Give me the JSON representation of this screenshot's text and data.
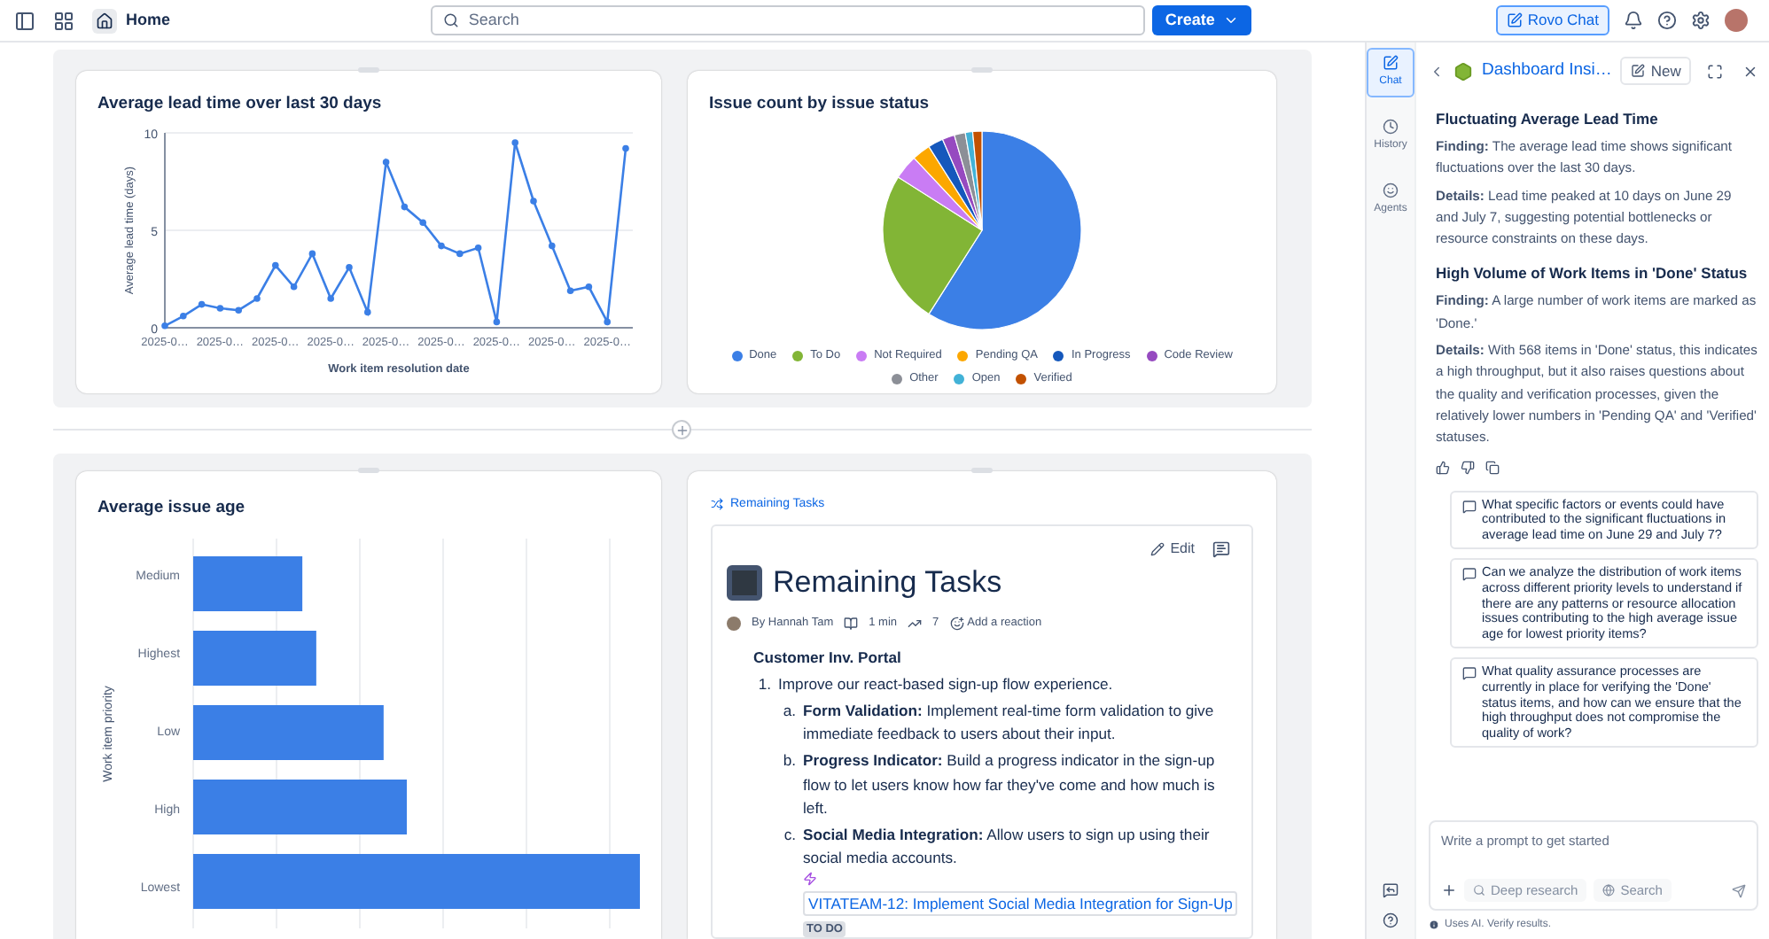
{
  "top_bar": {
    "home_label": "Home",
    "search": {
      "placeholder": "Search"
    },
    "create_button": "Create",
    "rovo_button": {
      "label": "Rovo Chat",
      "selected": true
    }
  },
  "lead_time_card": {
    "title": "Average lead time over last 30 days",
    "chart_data": {
      "type": "line",
      "xlabel": "Work item resolution date",
      "ylabel": "Average lead time (days)",
      "categories": [
        "2025-0…",
        null,
        null,
        "2025-0…",
        null,
        null,
        "2025-0…",
        null,
        null,
        "2025-0…",
        null,
        null,
        "2025-0…",
        null,
        null,
        "2025-0…",
        null,
        null,
        "2025-0…",
        null,
        null,
        "2025-0…",
        null,
        null,
        "2025-0…",
        null
      ],
      "series": [
        {
          "color": "#3b7fe6",
          "marker": true,
          "values": [
            0.1,
            0.6,
            1.2,
            1.0,
            0.9,
            1.5,
            3.2,
            2.1,
            3.8,
            1.5,
            3.1,
            0.8,
            8.5,
            6.2,
            5.4,
            4.2,
            3.8,
            4.1,
            0.3,
            9.5,
            6.5,
            4.2,
            1.9,
            2.1,
            0.3,
            9.2
          ]
        }
      ],
      "ylim": [
        0,
        10
      ],
      "yticks": [
        0,
        5,
        10
      ]
    }
  },
  "status_card": {
    "title": "Issue count by issue status",
    "legend": [
      {
        "label": "Done",
        "color": "#3b7fe6"
      },
      {
        "label": "To Do",
        "color": "#82b536"
      },
      {
        "label": "Not Required",
        "color": "#c97cf4"
      },
      {
        "label": "Pending QA",
        "color": "#fca700"
      },
      {
        "label": "In Progress",
        "color": "#1558bc"
      },
      {
        "label": "Code Review",
        "color": "#964ac0"
      },
      {
        "label": "Other",
        "color": "#8c8f97"
      },
      {
        "label": "Open",
        "color": "#42b2d7"
      },
      {
        "label": "Verified",
        "color": "#c25100"
      }
    ]
  },
  "age_card": {
    "title": "Average issue age",
    "ylabel": "Work item priority",
    "categories": [
      "Medium",
      "Highest",
      "Low",
      "High",
      "Lowest"
    ]
  },
  "page_card": {
    "link": "Remaining Tasks",
    "edit_button": "Edit",
    "title": "Remaining Tasks",
    "byline": {
      "author": "By Hannah Tam",
      "read_time": "1 min",
      "views": "7",
      "reaction": "Add a reaction"
    },
    "section": "Customer Inv. Portal",
    "list": [
      {
        "marker": "1.",
        "text": "Improve our react-based sign-up flow experience.",
        "children": [
          {
            "marker": "a.",
            "text": "**Form Validation:** Implement real-time form validation to give immediate feedback to users about their input."
          },
          {
            "marker": "b.",
            "text": "**Progress Indicator:** Build a progress indicator in the sign-up flow to let users know how far they've come and how much is left."
          },
          {
            "marker": "c.",
            "text": "**Social Media Integration:** Allow users to sign up using their social media accounts.",
            "link": "VITATEAM-12: Implement Social Media Integration for Sign-Up",
            "status": "TO DO"
          }
        ]
      }
    ]
  },
  "assistant": {
    "rail": [
      {
        "label": "Chat",
        "selected": true
      },
      {
        "label": "History",
        "selected": false
      },
      {
        "label": "Agents",
        "selected": false
      }
    ],
    "title": "Dashboard Insi…",
    "new_button": "New",
    "sections": [
      {
        "heading": "Fluctuating Average Lead Time",
        "paragraphs": [
          "**Finding:** The average lead time shows significant fluctuations over the last 30 days.",
          "**Details:** Lead time peaked at 10 days on June 29 and July 7, suggesting potential bottlenecks or resource constraints on these days."
        ]
      },
      {
        "heading": "High Volume of Work Items in 'Done' Status",
        "paragraphs": [
          "**Finding:** A large number of work items are marked as 'Done.'",
          "**Details:** With 568 items in 'Done' status, this indicates a high throughput, but it also raises questions about the quality and verification processes, given the relatively lower numbers in 'Pending QA' and 'Verified' statuses."
        ]
      }
    ],
    "suggestions": [
      "What specific factors or events could have contributed to the significant fluctuations in average lead time on June 29 and July 7?",
      "Can we analyze the distribution of work items across different priority levels to understand if there are any patterns or resource allocation issues contributing to the high average issue age for lowest priority items?",
      "What quality assurance processes are currently in place for verifying the 'Done' status items, and how can we ensure that the high throughput does not compromise the quality of work?"
    ],
    "prompt": {
      "placeholder": "Write a prompt to get started"
    },
    "tools": [
      "Deep research",
      "Search"
    ],
    "disclaimer": "Uses AI. Verify results."
  }
}
